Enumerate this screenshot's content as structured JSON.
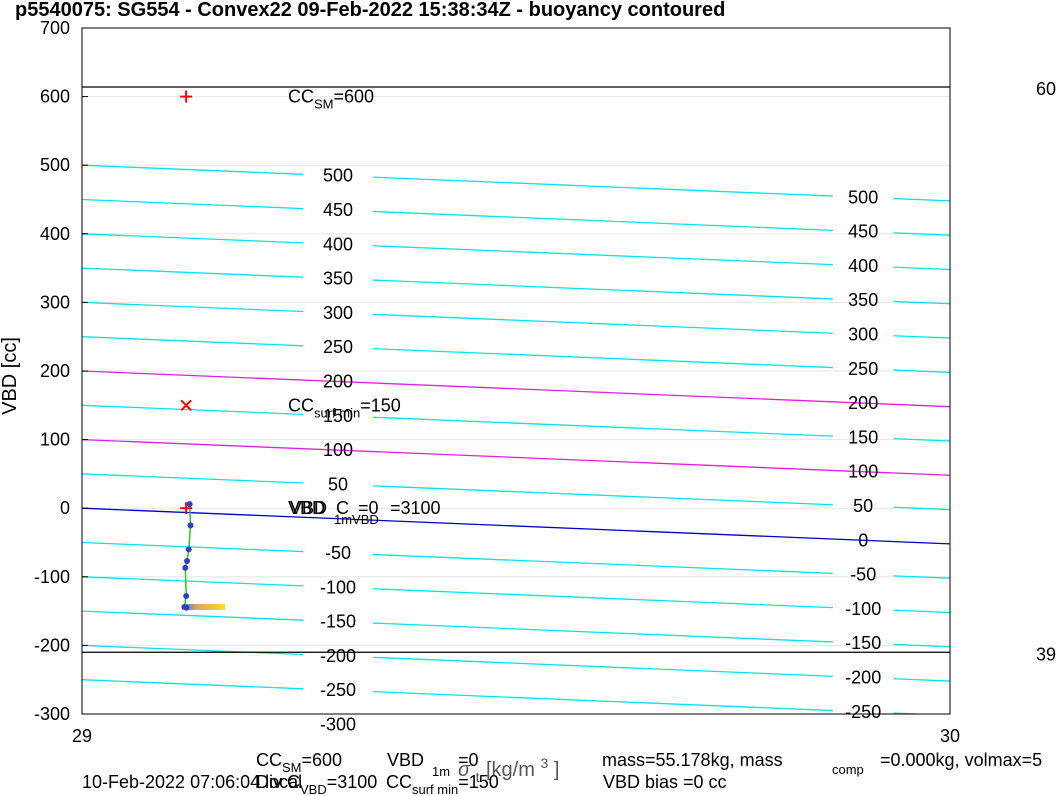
{
  "chart_data": {
    "type": "line",
    "title": "p5540075: SG554 - Convex22 09-Feb-2022 15:38:34Z - buoyancy contoured",
    "ylabel": "VBD [cc]",
    "xlabel_main": "σ",
    "xlabel_sub": "t",
    "xlabel_unit": "[kg/m",
    "xlabel_exp": "3",
    "xlabel_close": "]",
    "xlim": [
      29,
      30
    ],
    "ylim": [
      -300,
      700
    ],
    "x_ticks": [
      29,
      30
    ],
    "y_ticks": [
      -300,
      -200,
      -100,
      0,
      100,
      200,
      300,
      400,
      500,
      600,
      700
    ],
    "grid": true,
    "contour_slope": -52,
    "contours": [
      -300,
      -250,
      -200,
      -150,
      -100,
      -50,
      0,
      50,
      100,
      150,
      200,
      250,
      300,
      350,
      400,
      450,
      500
    ],
    "contour_labels_left": [
      "500",
      "450",
      "400",
      "350",
      "300",
      "250",
      "200",
      "150",
      "100",
      "50",
      "-50",
      "-100",
      "-150",
      "-200",
      "-250",
      "-300"
    ],
    "contour_labels_right": [
      "500",
      "450",
      "400",
      "350",
      "300",
      "250",
      "200",
      "150",
      "100",
      "50",
      "0",
      "-50",
      "-100",
      "-150",
      "-200",
      "-250"
    ],
    "magenta_contours": [
      100,
      200
    ],
    "blue_contour": 0,
    "colors": {
      "contour": "#00e5ee",
      "magenta": "#e020e0",
      "zero": "#0000cc",
      "marker": "#ff0000",
      "path": "#22cc22",
      "point": "#3040c0"
    },
    "hlines": [
      614,
      -210
    ],
    "hline_labels": [
      "60",
      "39"
    ],
    "markers": [
      {
        "x": 29.12,
        "y": 600,
        "symbol": "+",
        "label": "CC",
        "sub": "SM",
        "rest": "=600"
      },
      {
        "x": 29.12,
        "y": 150,
        "symbol": "x",
        "label": "CC",
        "sub": "surf min",
        "rest": "=150"
      },
      {
        "x": 29.12,
        "y": 0,
        "symbol": "+"
      }
    ],
    "zero_annotation": {
      "main": "VBD",
      "mid": "C",
      "sub": "1mVBD",
      "rest": "=0",
      "tail": "=3100"
    },
    "profile": [
      {
        "x": 29.124,
        "y": 6
      },
      {
        "x": 29.125,
        "y": -25
      },
      {
        "x": 29.123,
        "y": -60
      },
      {
        "x": 29.121,
        "y": -77
      },
      {
        "x": 29.119,
        "y": -87
      },
      {
        "x": 29.12,
        "y": -128
      },
      {
        "x": 29.118,
        "y": -144
      },
      {
        "x": 29.12,
        "y": -145
      }
    ],
    "heat_band": {
      "x0": 29.12,
      "x1": 29.165,
      "y": -144
    }
  },
  "footer": {
    "line1_a": "CC",
    "line1_a_sub": "SM",
    "line1_a_rest": "=600",
    "line1_b": "VBD",
    "line1_b_rest": "=0",
    "line1_b_sub": "1m",
    "line1_c": "mass=55.178kg, mass",
    "line1_c_sub": "comp",
    "line1_c_rest": "=0.000kg, volmax=5",
    "line2_date": "10-Feb-2022 07:06:04 local",
    "line2_div": "Div C",
    "line2_div_sub": "VBD",
    "line2_div_rest": "=3100",
    "line2_cc": "CC",
    "line2_cc_sub": "surf min",
    "line2_cc_rest": "=150",
    "line2_bias": "VBD bias =0 cc"
  }
}
